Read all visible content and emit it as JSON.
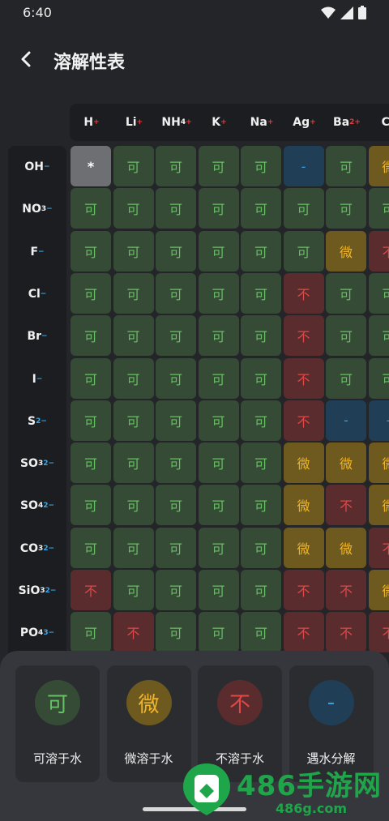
{
  "status": {
    "time": "6:40"
  },
  "appbar": {
    "title": "溶解性表"
  },
  "columns": [
    {
      "base": "H",
      "sup": "+",
      "sup_color": "red"
    },
    {
      "base": "Li",
      "sup": "+",
      "sup_color": "red"
    },
    {
      "base": "NH",
      "sub": "4",
      "sup": "+",
      "sup_color": "red"
    },
    {
      "base": "K",
      "sup": "+",
      "sup_color": "red"
    },
    {
      "base": "Na",
      "sup": "+",
      "sup_color": "red"
    },
    {
      "base": "Ag",
      "sup": "+",
      "sup_color": "red"
    },
    {
      "base": "Ba",
      "sup": "2+",
      "sup_color": "red"
    },
    {
      "base": "Ca"
    }
  ],
  "rows": [
    {
      "base": "OH",
      "sup": "−",
      "cells": [
        "*",
        "可",
        "可",
        "可",
        "可",
        "-",
        "可",
        "微"
      ]
    },
    {
      "base": "NO",
      "sub": "3",
      "sup": "−",
      "cells": [
        "可",
        "可",
        "可",
        "可",
        "可",
        "可",
        "可",
        "可"
      ]
    },
    {
      "base": "F",
      "sup": "−",
      "cells": [
        "可",
        "可",
        "可",
        "可",
        "可",
        "可",
        "微",
        "不"
      ]
    },
    {
      "base": "Cl",
      "sup": "−",
      "cells": [
        "可",
        "可",
        "可",
        "可",
        "可",
        "不",
        "可",
        "可"
      ]
    },
    {
      "base": "Br",
      "sup": "−",
      "cells": [
        "可",
        "可",
        "可",
        "可",
        "可",
        "不",
        "可",
        "可"
      ]
    },
    {
      "base": "I",
      "sup": "−",
      "cells": [
        "可",
        "可",
        "可",
        "可",
        "可",
        "不",
        "可",
        "可"
      ]
    },
    {
      "base": "S",
      "sup": "2−",
      "cells": [
        "可",
        "可",
        "可",
        "可",
        "可",
        "不",
        "-",
        "-"
      ]
    },
    {
      "base": "SO",
      "sub": "3",
      "sup": "2−",
      "cells": [
        "可",
        "可",
        "可",
        "可",
        "可",
        "微",
        "微",
        "微"
      ]
    },
    {
      "base": "SO",
      "sub": "4",
      "sup": "2−",
      "cells": [
        "可",
        "可",
        "可",
        "可",
        "可",
        "微",
        "不",
        "微"
      ]
    },
    {
      "base": "CO",
      "sub": "3",
      "sup": "2−",
      "cells": [
        "可",
        "可",
        "可",
        "可",
        "可",
        "微",
        "微",
        "不"
      ]
    },
    {
      "base": "SiO",
      "sub": "3",
      "sup": "2−",
      "cells": [
        "不",
        "可",
        "可",
        "可",
        "可",
        "不",
        "不",
        "微"
      ]
    },
    {
      "base": "PO",
      "sub": "4",
      "sup": "3−",
      "cells": [
        "可",
        "不",
        "可",
        "可",
        "可",
        "不",
        "不",
        "不"
      ]
    }
  ],
  "legend": [
    {
      "symbol": "可",
      "label": "可溶于水",
      "kind": "green"
    },
    {
      "symbol": "微",
      "label": "微溶于水",
      "kind": "yellow"
    },
    {
      "symbol": "不",
      "label": "不溶于水",
      "kind": "red"
    },
    {
      "symbol": "-",
      "label": "遇水分解",
      "kind": "blue"
    }
  ],
  "watermark": {
    "text": "486手游网",
    "sub": "486g.com"
  },
  "colors": {
    "green": "#67c064",
    "yellow": "#f0b52a",
    "red": "#e04848",
    "blue": "#3a9fe0"
  }
}
